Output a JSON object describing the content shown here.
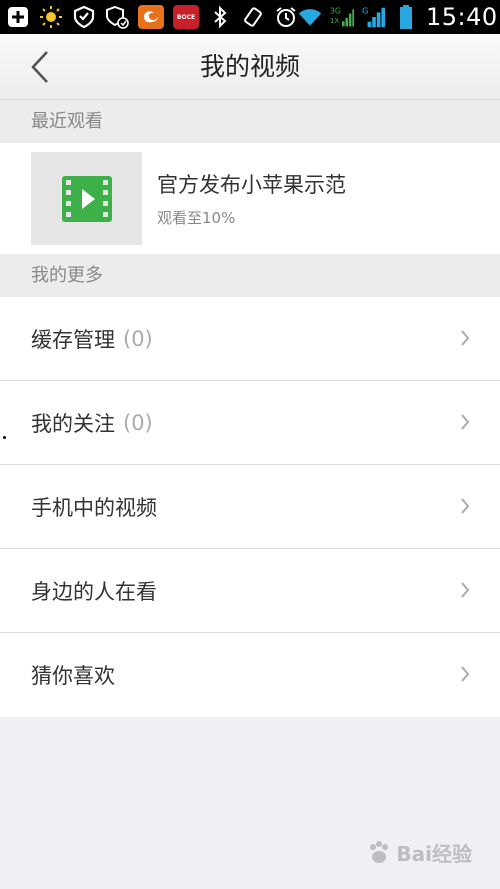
{
  "status_bar": {
    "time": "15:40",
    "network_label": "3G",
    "icons": [
      "add-icon",
      "brightness-icon",
      "shield-icon",
      "security-icon",
      "uc-browser-icon",
      "boce-app-icon",
      "bluetooth-icon",
      "rotate-icon",
      "alarm-icon",
      "wifi-icon",
      "signal-3g-icon",
      "signal-icon",
      "battery-icon"
    ]
  },
  "header": {
    "title": "我的视频",
    "back_icon": "chevron-left-icon"
  },
  "recent": {
    "section_title": "最近观看",
    "item": {
      "title": "官方发布小苹果示范",
      "progress": "观看至10%",
      "thumbnail_icon": "video-play-icon"
    }
  },
  "more": {
    "section_title": "我的更多",
    "items": [
      {
        "label": "缓存管理",
        "count": "(0)"
      },
      {
        "label": "我的关注",
        "count": "(0)"
      },
      {
        "label": "手机中的视频",
        "count": ""
      },
      {
        "label": "身边的人在看",
        "count": ""
      },
      {
        "label": "猜你喜欢",
        "count": ""
      }
    ]
  },
  "watermark": "Bai经验",
  "colors": {
    "accent_green": "#3eb049",
    "section_bg": "#ececec",
    "page_bg": "#efeff4"
  }
}
